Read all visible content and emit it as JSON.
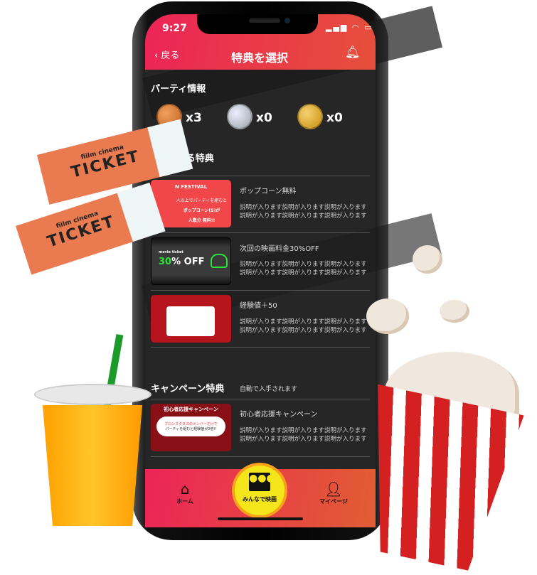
{
  "status": {
    "time": "9:27"
  },
  "header": {
    "back_label": "戻る",
    "title": "特典を選択",
    "bell_icon": "bell-icon"
  },
  "party": {
    "title": "パーティ情報",
    "coins": [
      {
        "type": "bronze",
        "color": "#d2691e",
        "count": "x3"
      },
      {
        "type": "silver",
        "color": "#aeb6b8",
        "count": "x0"
      },
      {
        "type": "gold",
        "color": "#d9a21c",
        "count": "x0"
      }
    ]
  },
  "perks": {
    "title": "利用できる特典",
    "visible_title": "きる特典",
    "items": [
      {
        "title": "ポップコーン無料",
        "desc1": "説明が入ります説明が入ります説明が入ります",
        "desc2": "説明が入ります説明が入ります説明が入ります",
        "img_text1": "N FESTIVAL",
        "img_text2": "人以上でパーティを組むと",
        "img_text3": "ポップコーン(S)が",
        "img_text4": "人数分 無料!!"
      },
      {
        "title": "次回の映画料金30%OFF",
        "desc1": "説明が入ります説明が入ります説明が入ります",
        "desc2": "説明が入ります説明が入ります説明が入ります",
        "img_small": "movie ticket",
        "img_pct": "30",
        "img_off": "% OFF"
      },
      {
        "title": "経験値＋50",
        "desc1": "説明が入ります説明が入ります説明が入ります",
        "desc2": "説明が入ります説明が入ります説明が入ります"
      }
    ]
  },
  "campaign": {
    "title": "キャンペーン特典",
    "note": "自動で入手されます",
    "items": [
      {
        "title": "初心者応援キャンペーン",
        "desc1": "説明が入ります説明が入ります説明が入ります",
        "desc2": "説明が入ります説明が入ります説明が入ります",
        "img_title": "初心者応援キャンペーン",
        "img_line1": "ブロンズクラスのメンバーだけで",
        "img_line2": "パーティを組むと経験値が2倍!!"
      }
    ]
  },
  "nav": {
    "home": "ホーム",
    "center": "みんなで映画",
    "mypage": "マイページ"
  },
  "decor": {
    "ticket_brand": "fiilm cinema",
    "ticket_word": "TICKET"
  },
  "colors": {
    "header_start": "#ec2457",
    "header_end": "#e6503a",
    "content_bg": "#262626",
    "center_button": "#f5e61c"
  }
}
